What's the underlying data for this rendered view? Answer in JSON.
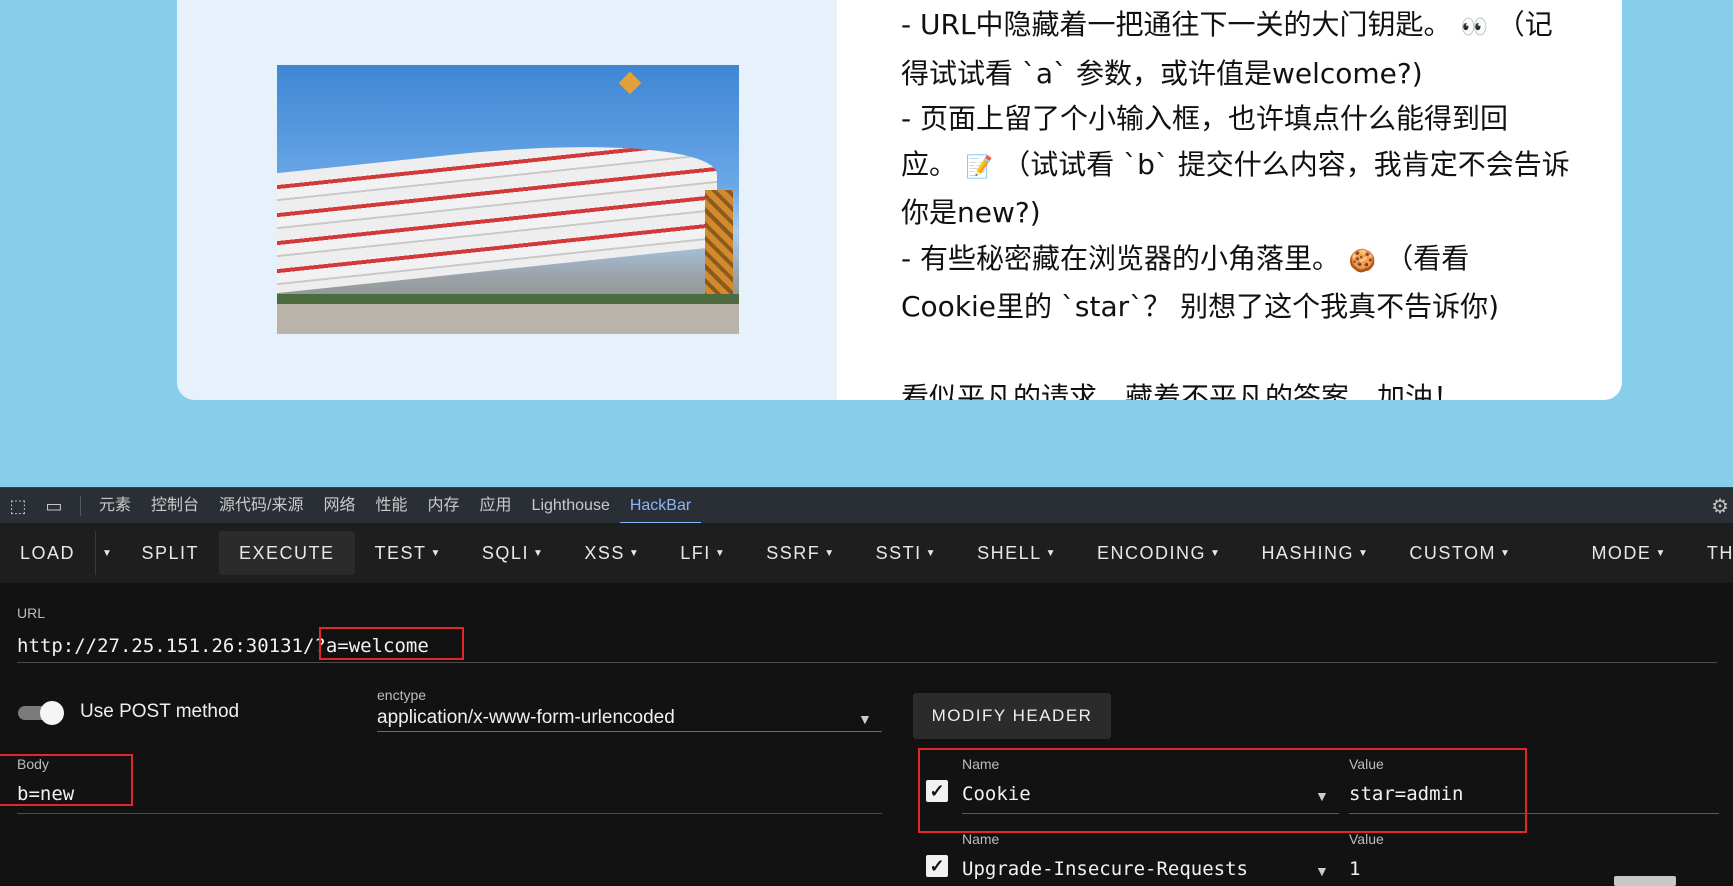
{
  "page": {
    "lines": [
      "- URL中隐藏着一把通往下一关的大门钥匙。",
      "（记",
      "得试试看 `a` 参数，或许值是welcome?)",
      "- 页面上留了个小输入框，也许填点什么能得到回",
      "应。",
      "（试试看 `b` 提交什么内容，我肯定不会告诉",
      "你是new?)",
      "- 有些秘密藏在浏览器的小角落里。",
      "（看看",
      "Cookie里的 `star`？ 别想了这个我真不告诉你)",
      "看似平凡的请求，藏着不平凡的答案，加油！"
    ],
    "emojis": [
      "👀",
      "📝",
      "🍪"
    ]
  },
  "devtools": {
    "tabs": [
      "元素",
      "控制台",
      "源代码/来源",
      "网络",
      "性能",
      "内存",
      "应用",
      "Lighthouse",
      "HackBar"
    ],
    "active_tab": "HackBar"
  },
  "hackbar": {
    "toolbar": {
      "load": "LOAD",
      "split": "SPLIT",
      "execute": "EXECUTE",
      "test": "TEST",
      "sqli": "SQLI",
      "xss": "XSS",
      "lfi": "LFI",
      "ssrf": "SSRF",
      "ssti": "SSTI",
      "shell": "SHELL",
      "encoding": "ENCODING",
      "hashing": "HASHING",
      "custom": "CUSTOM",
      "mode": "MODE",
      "theme": "THE"
    },
    "url_label": "URL",
    "url_base": "http://27.25.151.26:30131/",
    "url_query": "?a=welcome",
    "use_post_label": "Use POST method",
    "use_post": true,
    "enctype_label": "enctype",
    "enctype_value": "application/x-www-form-urlencoded",
    "modify_header": "MODIFY HEADER",
    "body_label": "Body",
    "body_value": "b=new",
    "headers": [
      {
        "name_label": "Name",
        "name": "Cookie",
        "value_label": "Value",
        "value": "star=admin",
        "checked": true
      },
      {
        "name_label": "Name",
        "name": "Upgrade-Insecure-Requests",
        "value_label": "Value",
        "value": "1",
        "checked": true
      }
    ]
  },
  "colors": {
    "highlight": "#e0272a",
    "page_bg": "#87ceeb",
    "accent_tab": "#8ab4f8"
  }
}
